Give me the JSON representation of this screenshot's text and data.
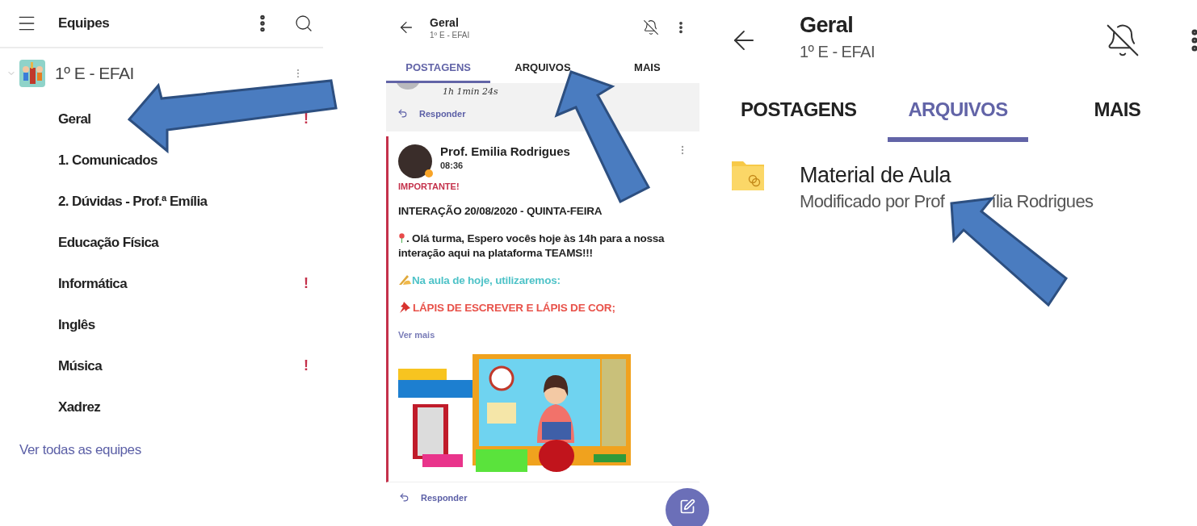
{
  "teams_panel": {
    "title": "Equipes",
    "team": {
      "name": "1º E - EFAI",
      "expanded": true,
      "channels": [
        {
          "name": "Geral",
          "badge": "!"
        },
        {
          "name": "1. Comunicados"
        },
        {
          "name": "2. Dúvidas - Prof.ª Emília"
        },
        {
          "name": "Educação Física"
        },
        {
          "name": "Informática",
          "badge": "!"
        },
        {
          "name": "Inglês"
        },
        {
          "name": "Música",
          "badge": "!"
        },
        {
          "name": "Xadrez"
        }
      ]
    },
    "link": "Ver todas as equipes",
    "pointer_arrow": true
  },
  "posts_panel": {
    "title": "Geral",
    "subtitle": "1º E - EFAI",
    "tabs": [
      {
        "label": "POSTAGENS",
        "selected": true
      },
      {
        "label": "ARQUIVOS",
        "selected": false
      },
      {
        "label": "MAIS",
        "selected": false
      }
    ],
    "previous_message": {
      "duration": "1h 1min 24s",
      "reply": "Responder"
    },
    "post": {
      "author": "Prof. Emilia Rodrigues",
      "time": "08:36",
      "label": "IMPORTANTE!",
      "lines": [
        {
          "kind": "heading",
          "text": "INTERAÇÃO 20/08/2020 - QUINTA-FEIRA"
        },
        {
          "kind": "greeting",
          "text": ". Olá turma, Espero vocês hoje às 14h para a nossa interação aqui na plataforma TEAMS!!!"
        },
        {
          "kind": "note",
          "text": "Na aula de hoje, utilizaremos:"
        },
        {
          "kind": "item",
          "text": "LÁPIS DE ESCREVER E LÁPIS DE COR;"
        }
      ],
      "more": "Ver mais"
    },
    "reply": "Responder",
    "pointer_arrow": true
  },
  "files_panel": {
    "title": "Geral",
    "subtitle": "1º E - EFAI",
    "tabs": [
      {
        "label": "POSTAGENS",
        "selected": false
      },
      {
        "label": "ARQUIVOS",
        "selected": true
      },
      {
        "label": "MAIS",
        "selected": false
      }
    ],
    "files": [
      {
        "name": "Material de Aula",
        "modified_parts": [
          "Modificado por Prof",
          "ília Rodrigues"
        ]
      }
    ],
    "pointer_arrow": true
  }
}
